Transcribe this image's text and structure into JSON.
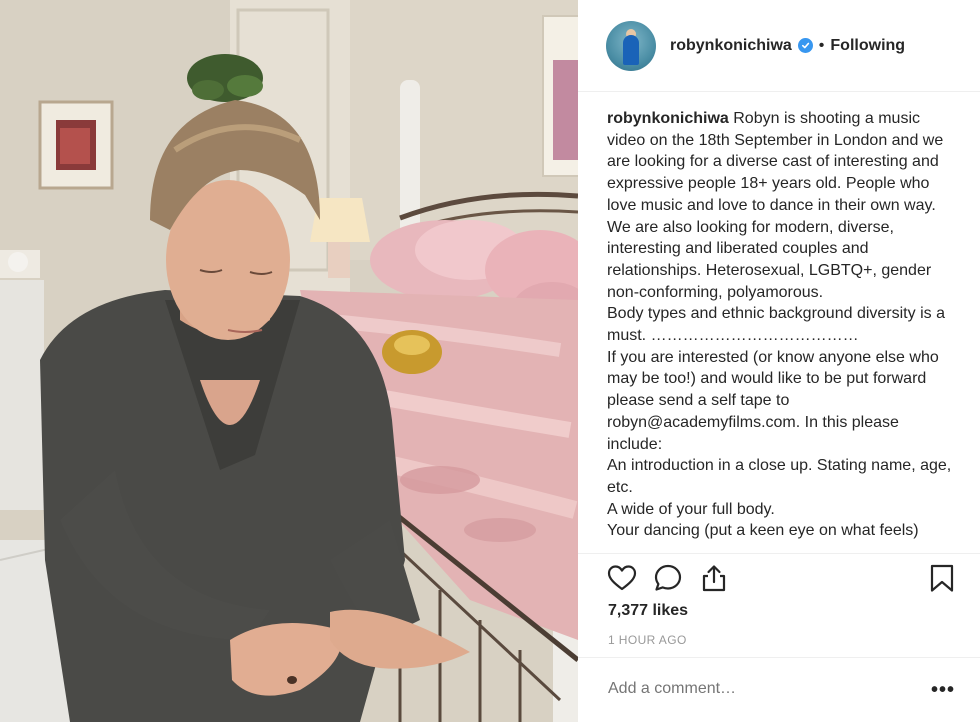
{
  "post": {
    "username": "robynkonichiwa",
    "verified": true,
    "separator": "•",
    "follow_status": "Following",
    "caption_lines": [
      "Robyn is shooting a music video on the 18th September in London and we are looking for a diverse cast of interesting and expressive people 18+ years old. People who love music and love to dance in their own way.",
      "We are also looking for modern, diverse, interesting and liberated couples and relationships. Heterosexual, LGBTQ+, gender non-conforming, polyamorous.",
      "Body types and ethnic background diversity is a must. …………………………………",
      "If you are interested (or know anyone else who may be too!) and would like to be put forward please send a self tape to robyn@academyfilms.com. In this please include:",
      "An introduction in a close up. Stating name, age, etc.",
      "A wide of your full body.",
      "Your dancing (put a keen eye on what feels)"
    ],
    "likes": "7,377 likes",
    "timestamp": "1 HOUR AGO",
    "comment_placeholder": "Add a comment…",
    "more_label": "•••"
  },
  "icons": {
    "like": "heart-icon",
    "comment": "comment-icon",
    "share": "share-icon",
    "save": "bookmark-icon",
    "verified": "verified-badge-icon"
  },
  "colors": {
    "text": "#262626",
    "muted": "#999999",
    "divider": "#efefef",
    "verified": "#3897f0"
  }
}
